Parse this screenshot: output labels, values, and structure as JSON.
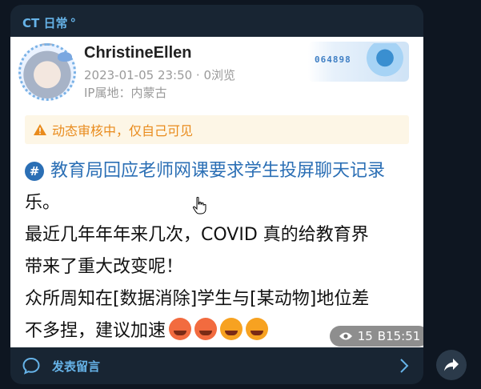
{
  "channel": {
    "name": "CT 日常",
    "dot": "°"
  },
  "post": {
    "username": "ChristineEllen",
    "date_views": "2023-01-05 23:50 · 0浏览",
    "ip_location": "IP属地：内蒙古",
    "badge_number": "064898",
    "warning": "动态审核中，仅自己可见",
    "topic": "教育局回应老师网课要求学生投屏聊天记录",
    "lines": [
      "乐。",
      "最近几年年年来几次，COVID 真的给教育界",
      "带来了重大改变呢！",
      "众所周知在[数据消除]学生与[某动物]地位差",
      "不多捏，建议加速"
    ]
  },
  "views": {
    "count": "15",
    "time": "B15:51"
  },
  "footer": {
    "comment_label": "发表留言"
  },
  "colors": {
    "accent": "#66b3e8",
    "bg": "#0e1621",
    "bubble": "#182533",
    "warn": "#e98b1c",
    "topic": "#2b6fb5"
  }
}
